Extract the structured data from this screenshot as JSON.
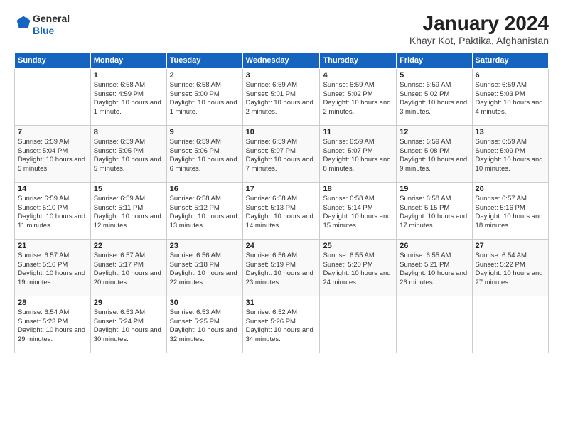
{
  "logo": {
    "general": "General",
    "blue": "Blue"
  },
  "title": "January 2024",
  "subtitle": "Khayr Kot, Paktika, Afghanistan",
  "weekdays": [
    "Sunday",
    "Monday",
    "Tuesday",
    "Wednesday",
    "Thursday",
    "Friday",
    "Saturday"
  ],
  "weeks": [
    [
      null,
      {
        "num": "1",
        "sunrise": "6:58 AM",
        "sunset": "4:59 PM",
        "daylight": "10 hours and 1 minute."
      },
      {
        "num": "2",
        "sunrise": "6:58 AM",
        "sunset": "5:00 PM",
        "daylight": "10 hours and 1 minute."
      },
      {
        "num": "3",
        "sunrise": "6:59 AM",
        "sunset": "5:01 PM",
        "daylight": "10 hours and 2 minutes."
      },
      {
        "num": "4",
        "sunrise": "6:59 AM",
        "sunset": "5:02 PM",
        "daylight": "10 hours and 2 minutes."
      },
      {
        "num": "5",
        "sunrise": "6:59 AM",
        "sunset": "5:02 PM",
        "daylight": "10 hours and 3 minutes."
      },
      {
        "num": "6",
        "sunrise": "6:59 AM",
        "sunset": "5:03 PM",
        "daylight": "10 hours and 4 minutes."
      }
    ],
    [
      {
        "num": "7",
        "sunrise": "6:59 AM",
        "sunset": "5:04 PM",
        "daylight": "10 hours and 5 minutes."
      },
      {
        "num": "8",
        "sunrise": "6:59 AM",
        "sunset": "5:05 PM",
        "daylight": "10 hours and 5 minutes."
      },
      {
        "num": "9",
        "sunrise": "6:59 AM",
        "sunset": "5:06 PM",
        "daylight": "10 hours and 6 minutes."
      },
      {
        "num": "10",
        "sunrise": "6:59 AM",
        "sunset": "5:07 PM",
        "daylight": "10 hours and 7 minutes."
      },
      {
        "num": "11",
        "sunrise": "6:59 AM",
        "sunset": "5:07 PM",
        "daylight": "10 hours and 8 minutes."
      },
      {
        "num": "12",
        "sunrise": "6:59 AM",
        "sunset": "5:08 PM",
        "daylight": "10 hours and 9 minutes."
      },
      {
        "num": "13",
        "sunrise": "6:59 AM",
        "sunset": "5:09 PM",
        "daylight": "10 hours and 10 minutes."
      }
    ],
    [
      {
        "num": "14",
        "sunrise": "6:59 AM",
        "sunset": "5:10 PM",
        "daylight": "10 hours and 11 minutes."
      },
      {
        "num": "15",
        "sunrise": "6:59 AM",
        "sunset": "5:11 PM",
        "daylight": "10 hours and 12 minutes."
      },
      {
        "num": "16",
        "sunrise": "6:58 AM",
        "sunset": "5:12 PM",
        "daylight": "10 hours and 13 minutes."
      },
      {
        "num": "17",
        "sunrise": "6:58 AM",
        "sunset": "5:13 PM",
        "daylight": "10 hours and 14 minutes."
      },
      {
        "num": "18",
        "sunrise": "6:58 AM",
        "sunset": "5:14 PM",
        "daylight": "10 hours and 15 minutes."
      },
      {
        "num": "19",
        "sunrise": "6:58 AM",
        "sunset": "5:15 PM",
        "daylight": "10 hours and 17 minutes."
      },
      {
        "num": "20",
        "sunrise": "6:57 AM",
        "sunset": "5:16 PM",
        "daylight": "10 hours and 18 minutes."
      }
    ],
    [
      {
        "num": "21",
        "sunrise": "6:57 AM",
        "sunset": "5:16 PM",
        "daylight": "10 hours and 19 minutes."
      },
      {
        "num": "22",
        "sunrise": "6:57 AM",
        "sunset": "5:17 PM",
        "daylight": "10 hours and 20 minutes."
      },
      {
        "num": "23",
        "sunrise": "6:56 AM",
        "sunset": "5:18 PM",
        "daylight": "10 hours and 22 minutes."
      },
      {
        "num": "24",
        "sunrise": "6:56 AM",
        "sunset": "5:19 PM",
        "daylight": "10 hours and 23 minutes."
      },
      {
        "num": "25",
        "sunrise": "6:55 AM",
        "sunset": "5:20 PM",
        "daylight": "10 hours and 24 minutes."
      },
      {
        "num": "26",
        "sunrise": "6:55 AM",
        "sunset": "5:21 PM",
        "daylight": "10 hours and 26 minutes."
      },
      {
        "num": "27",
        "sunrise": "6:54 AM",
        "sunset": "5:22 PM",
        "daylight": "10 hours and 27 minutes."
      }
    ],
    [
      {
        "num": "28",
        "sunrise": "6:54 AM",
        "sunset": "5:23 PM",
        "daylight": "10 hours and 29 minutes."
      },
      {
        "num": "29",
        "sunrise": "6:53 AM",
        "sunset": "5:24 PM",
        "daylight": "10 hours and 30 minutes."
      },
      {
        "num": "30",
        "sunrise": "6:53 AM",
        "sunset": "5:25 PM",
        "daylight": "10 hours and 32 minutes."
      },
      {
        "num": "31",
        "sunrise": "6:52 AM",
        "sunset": "5:26 PM",
        "daylight": "10 hours and 34 minutes."
      },
      null,
      null,
      null
    ]
  ]
}
